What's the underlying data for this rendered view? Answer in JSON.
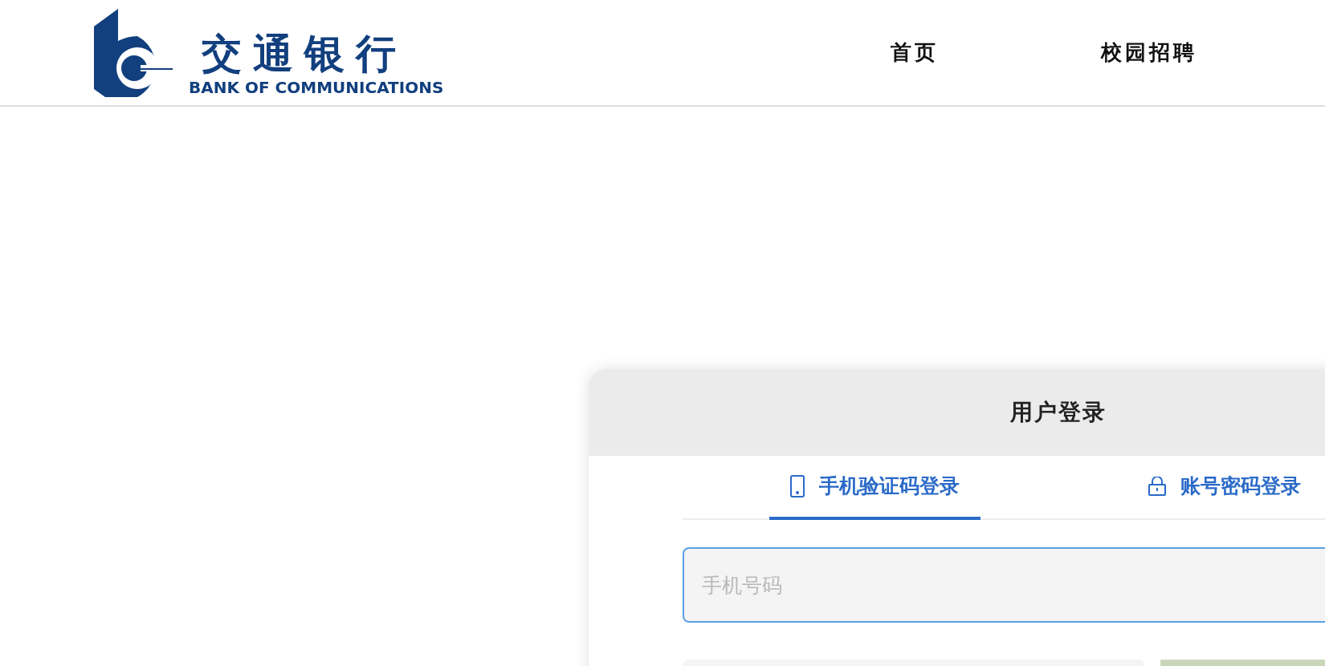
{
  "header": {
    "logo": {
      "name_cn": "交通银行",
      "name_en": "BANK OF COMMUNICATIONS"
    },
    "nav": [
      {
        "label": "首页"
      },
      {
        "label": "校园招聘"
      }
    ]
  },
  "login": {
    "title": "用户登录",
    "tabs": [
      {
        "kind": "phone",
        "label": "手机验证码登录",
        "selected": true
      },
      {
        "kind": "password",
        "label": "账号密码登录",
        "selected": false
      }
    ],
    "phone_field": {
      "placeholder": "手机号码"
    }
  }
}
